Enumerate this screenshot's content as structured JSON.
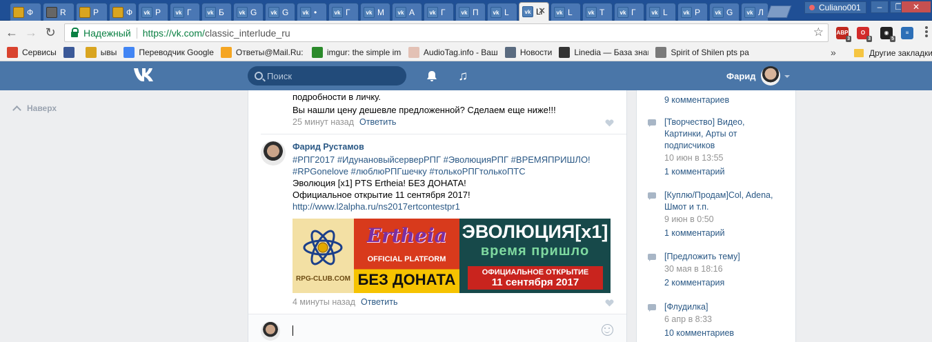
{
  "browser": {
    "tabs": [
      {
        "label": "Ф",
        "icon": "shield-icon"
      },
      {
        "label": "R",
        "icon": "image-icon"
      },
      {
        "label": "Р",
        "icon": "shield-icon"
      },
      {
        "label": "Ф",
        "icon": "shield-icon"
      },
      {
        "label": "Р",
        "icon": "vk-icon"
      },
      {
        "label": "Г",
        "icon": "vk-icon"
      },
      {
        "label": "Б",
        "icon": "vk-icon"
      },
      {
        "label": "G",
        "icon": "vk-icon"
      },
      {
        "label": "G",
        "icon": "vk-icon"
      },
      {
        "label": "•",
        "icon": "vk-icon"
      },
      {
        "label": "Г",
        "icon": "vk-icon"
      },
      {
        "label": "М",
        "icon": "vk-icon"
      },
      {
        "label": "А",
        "icon": "vk-icon"
      },
      {
        "label": "Г",
        "icon": "vk-icon"
      },
      {
        "label": "П",
        "icon": "vk-icon"
      },
      {
        "label": "L",
        "icon": "vk-icon"
      },
      {
        "label": "Li",
        "icon": "vk-icon",
        "active": true
      },
      {
        "label": "L",
        "icon": "vk-icon"
      },
      {
        "label": "Т",
        "icon": "vk-icon"
      },
      {
        "label": "Г",
        "icon": "vk-icon"
      },
      {
        "label": "L",
        "icon": "vk-icon"
      },
      {
        "label": "Р",
        "icon": "vk-icon"
      },
      {
        "label": "G",
        "icon": "vk-icon"
      },
      {
        "label": "Л",
        "icon": "vk-icon"
      }
    ],
    "profile_name": "Culiano001",
    "secure_label": "Надежный",
    "url_host": "https://vk.com/",
    "url_path": "classic_interlude_ru",
    "extensions": [
      {
        "name": "adblock-icon",
        "text": "ABP",
        "count": "3",
        "color": "#c0281e"
      },
      {
        "name": "opera-ext-icon",
        "text": "O",
        "count": "3",
        "color": "#d22b2b"
      },
      {
        "name": "ghost-ext-icon",
        "text": "◉",
        "count": "5",
        "color": "#222222"
      },
      {
        "name": "vk-ext-icon",
        "text": "≡",
        "count": "",
        "color": "#2d6fb7"
      }
    ],
    "bookmarks": [
      {
        "label": "Сервисы",
        "icon": "apps-icon",
        "color": "#d9432f"
      },
      {
        "label": "",
        "icon": "facebook-icon",
        "color": "#3b5998"
      },
      {
        "label": "ывы",
        "icon": "shield-icon",
        "color": "#d9a520"
      },
      {
        "label": "Переводчик Google",
        "icon": "translate-icon",
        "color": "#4285f4"
      },
      {
        "label": "Ответы@Mail.Ru: Tur",
        "icon": "question-icon",
        "color": "#f5a623"
      },
      {
        "label": "imgur: the simple ima",
        "icon": "imgur-icon",
        "color": "#2b8a2b"
      },
      {
        "label": "AudioTag.info - Ваш",
        "icon": "audiotag-icon",
        "color": "#e3c1b5"
      },
      {
        "label": "Новости",
        "icon": "news-icon",
        "color": "#5a6b80"
      },
      {
        "label": "Linedia — База знани",
        "icon": "linedia-icon",
        "color": "#333333"
      },
      {
        "label": "Spirit of Shilen pts pa",
        "icon": "page-icon",
        "color": "#7a7a7a"
      }
    ],
    "other_bookmarks": "Другие закладки"
  },
  "vk_header": {
    "logo": "VK",
    "search_placeholder": "Поиск",
    "user_name": "Фарид"
  },
  "left_nav": {
    "back_to_top": "Наверх"
  },
  "feed": {
    "prev_post": {
      "lines": [
        "подробности в личку.",
        "Вы нашли цену дешевле предложенной? Сделаем еще ниже!!!"
      ],
      "time": "25 минут назад",
      "reply": "Ответить"
    },
    "post": {
      "author": "Фарид Рустамов",
      "hashtags_line1": "#РПГ2017 #ИдунановыйсерверРПГ #ЭволюцияРПГ #ВРЕМЯПРИШЛО!",
      "hashtags_line2": "#RPGonelove #люблюРПГшечку #толькоРПГтолькоПТС",
      "line3": "Эволюция [x1] PTS Ertheia! БЕЗ ДОНАТА!",
      "line4": "Официальное открытие 11 сентября 2017!",
      "link": "http://www.l2alpha.ru/ns2017ertcontestpr1",
      "banner": {
        "rpg_club": "RPG-CLUB.COM",
        "ertheia": "Ertheia",
        "official_platform": "OFFICIAL PLATFORM",
        "no_donate": "БЕЗ ДОНАТА",
        "evolution": "ЭВОЛЮЦИЯ[x1]",
        "time_has_come": "время пришло",
        "official_opening": "ОФИЦИАЛЬНОЕ ОТКРЫТИЕ",
        "date": "11 сентября 2017"
      },
      "time": "4 минуты назад",
      "reply": "Ответить"
    }
  },
  "discussions": [
    {
      "title": "",
      "date": "",
      "count": "9 комментариев"
    },
    {
      "title": "[Творчество] Видео, Картинки, Арты от подписчиков",
      "date": "10 июн в 13:55",
      "count": "1 комментарий"
    },
    {
      "title": "[Куплю/Продам]Col, Adena, Шмот и т.п.",
      "date": "9 июн в 0:50",
      "count": "1 комментарий"
    },
    {
      "title": "[Предложить тему]",
      "date": "30 мая в 18:16",
      "count": "2 комментария"
    },
    {
      "title": "[Флудилка]",
      "date": "6 апр в 8:33",
      "count": "10 комментариев"
    }
  ]
}
